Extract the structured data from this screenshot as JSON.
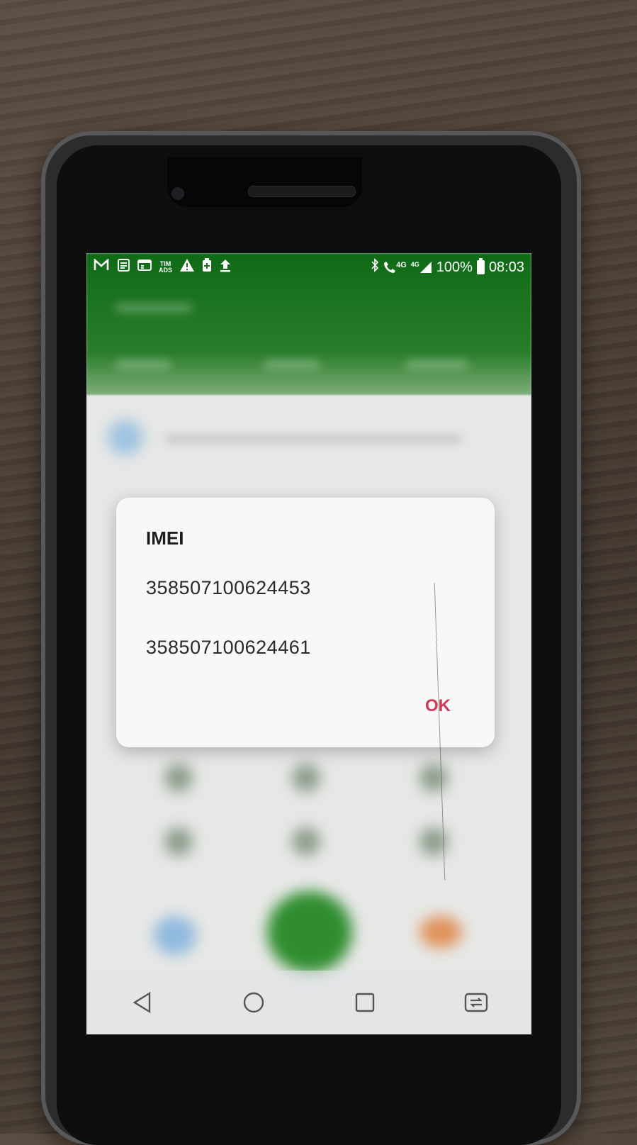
{
  "status_bar": {
    "left_icons": [
      "gmail-icon",
      "news-icon",
      "calendar-icon",
      "tim-ads-icon",
      "warning-icon",
      "battery-saver-icon",
      "upload-icon"
    ],
    "tim_ads_line1": "TIM",
    "tim_ads_line2": "ADS",
    "right_icons": [
      "bluetooth-icon",
      "call-icon",
      "4g-icon",
      "signal-icon"
    ],
    "call_network": "4G",
    "signal_network": "4G",
    "battery_percent": "100%",
    "time": "08:03"
  },
  "dialog": {
    "title": "IMEI",
    "imei_1": "358507100624453",
    "imei_2": "358507100624461",
    "ok_label": "OK"
  },
  "nav_bar": {
    "buttons": [
      "back-icon",
      "home-icon",
      "recents-icon",
      "dual-window-icon"
    ]
  },
  "colors": {
    "header_green": "#0f6a16",
    "ok_accent": "#cc3a57"
  }
}
